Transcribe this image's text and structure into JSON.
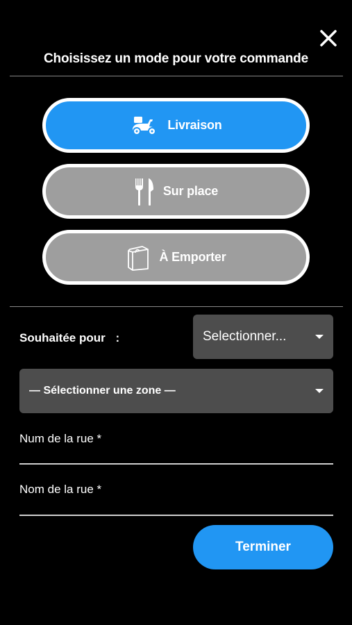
{
  "header": {
    "title": "Choisissez un mode pour votre commande",
    "close_icon": "close-icon"
  },
  "modes": [
    {
      "label": "Livraison",
      "icon": "scooter-icon",
      "state": "selected"
    },
    {
      "label": "Sur place",
      "icon": "fork-knife-icon",
      "state": "unselected"
    },
    {
      "label": "À Emporter",
      "icon": "paper-bag-icon",
      "state": "unselected"
    }
  ],
  "form": {
    "schedule_label": "Souhaitée pour",
    "schedule_colon": ":",
    "schedule_select": "Selectionner...",
    "zone_select": "— Sélectionner une zone —",
    "street_number_label": "Num de la rue *",
    "street_name_label": "Nom de la rue *"
  },
  "actions": {
    "finish_label": "Terminer"
  },
  "colors": {
    "accent": "#2196f3",
    "inactive": "#9e9e9e",
    "select_bg": "#4d4d4d",
    "background": "#000000"
  }
}
